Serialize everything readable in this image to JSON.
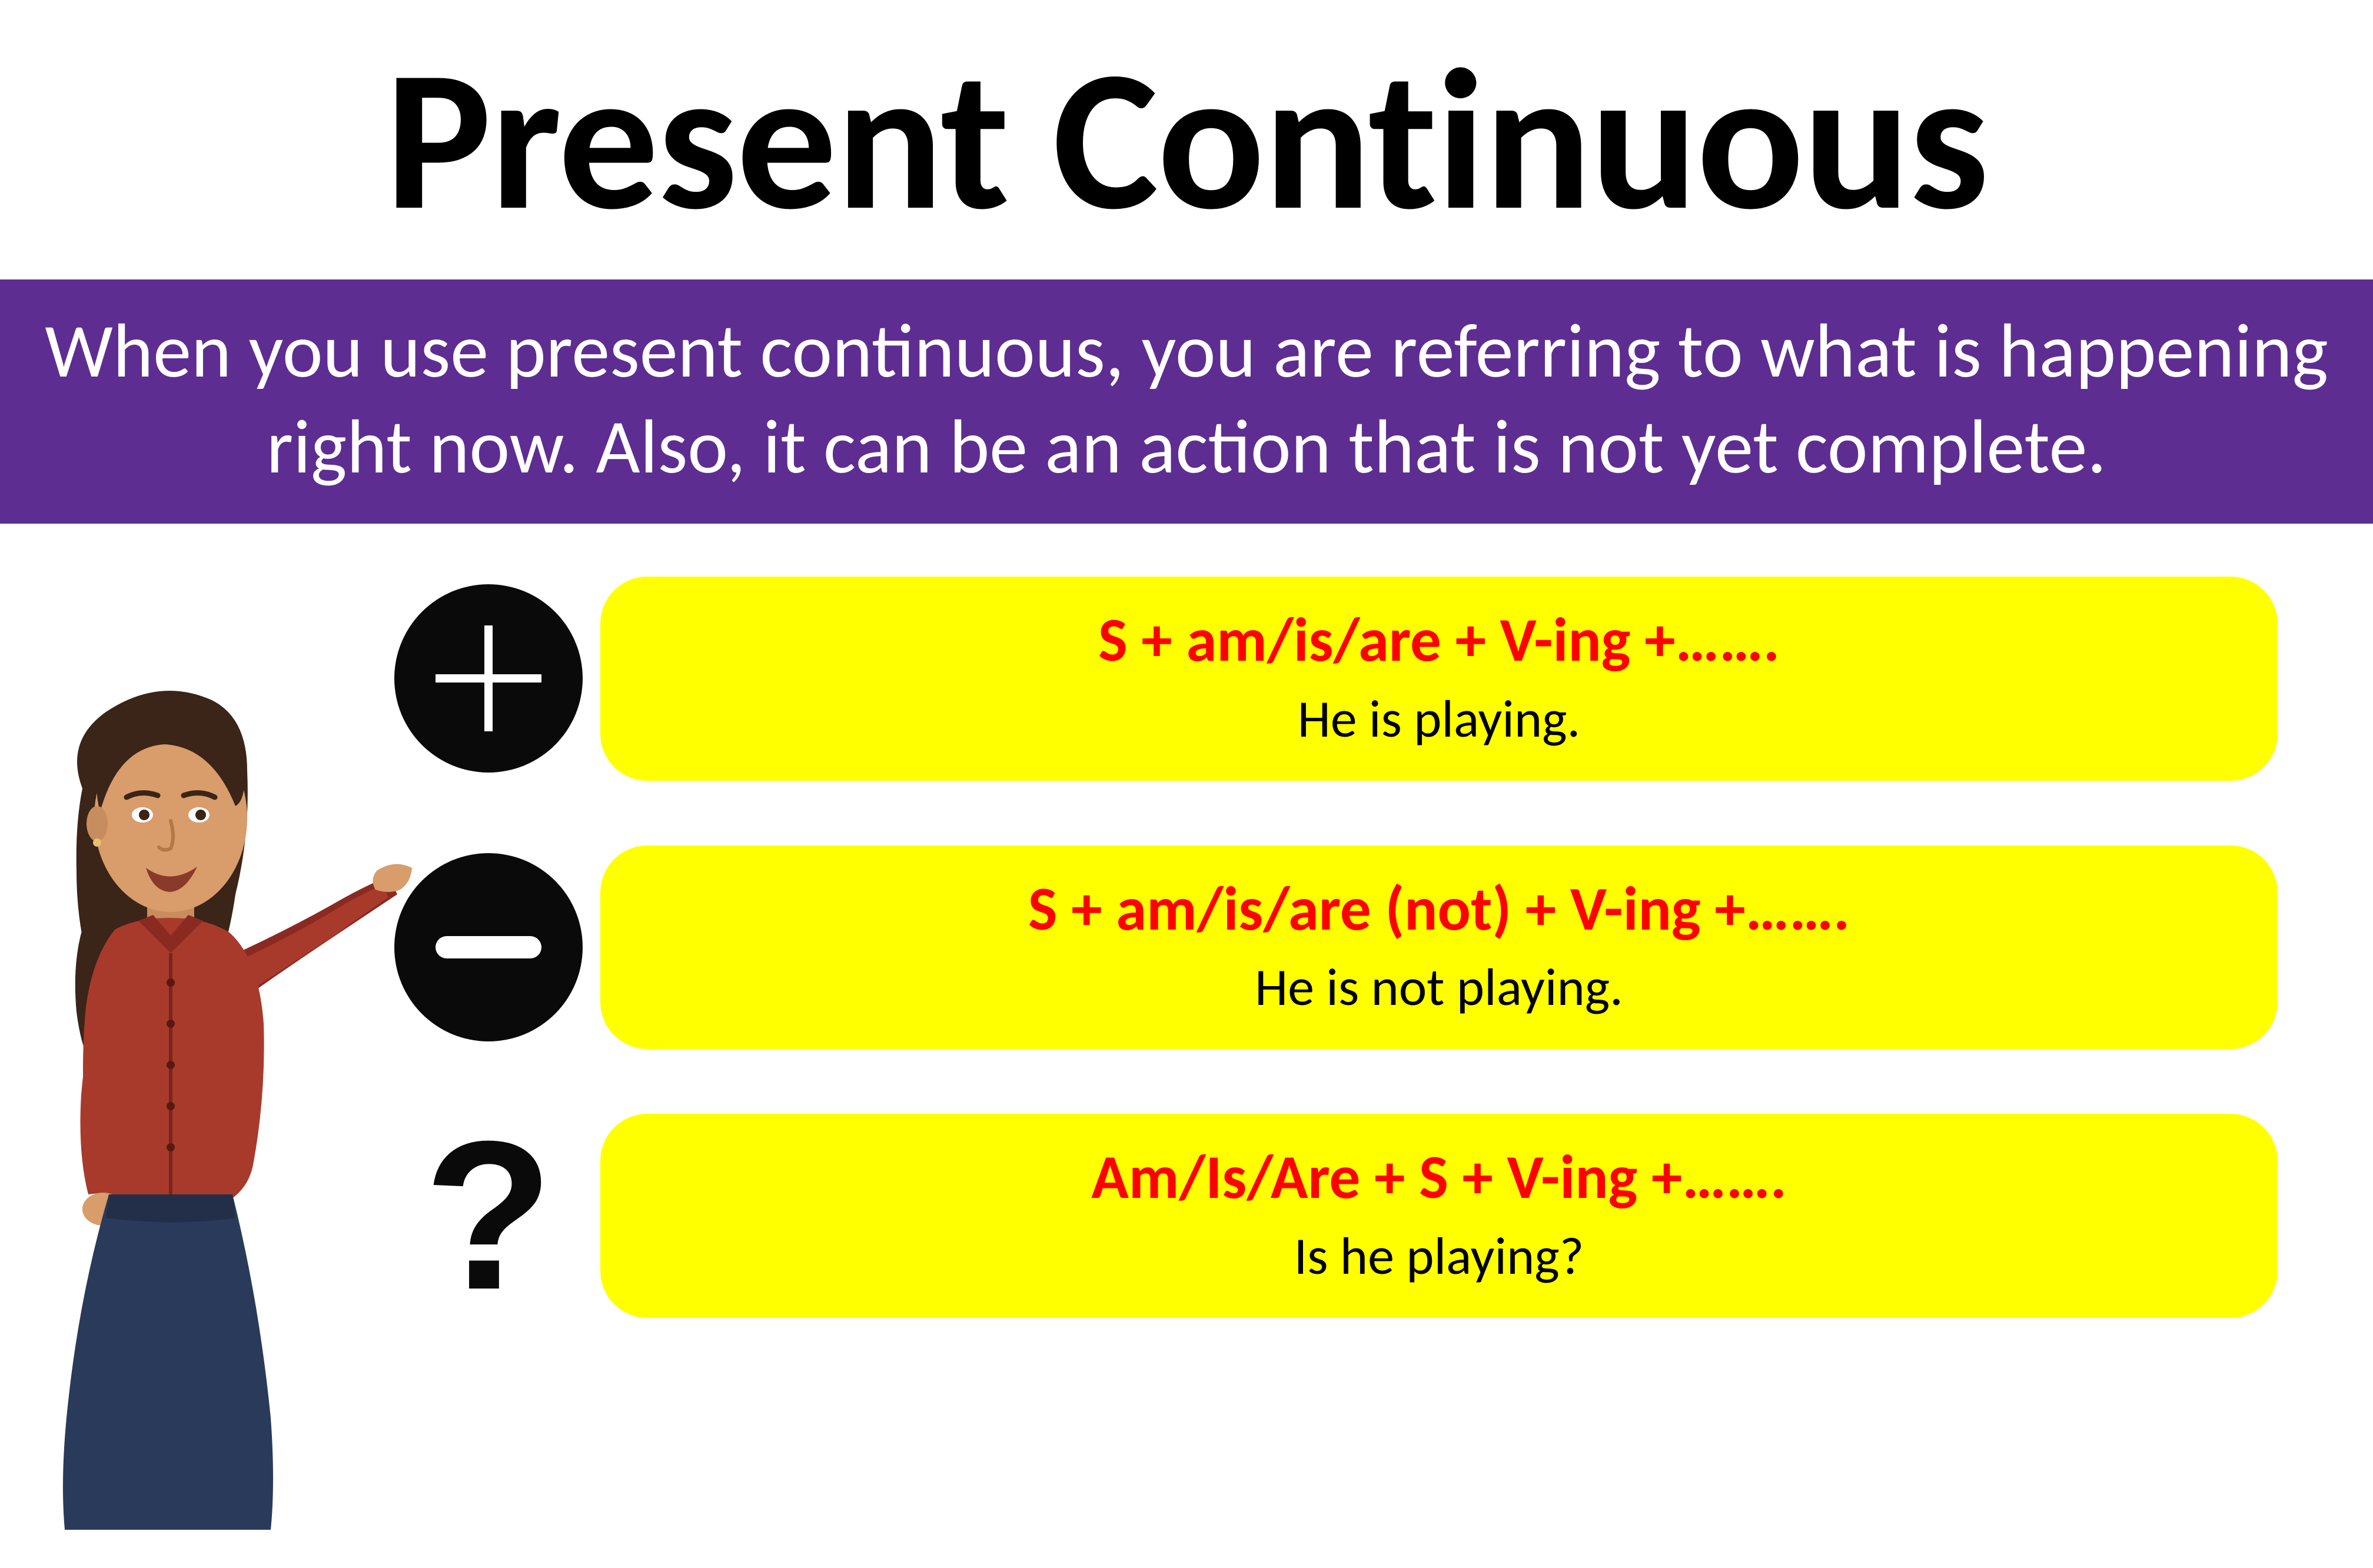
{
  "title": "Present Continuous",
  "subtitle": "When you use present continuous, you are referring to what is happening right now. Also, it can be an action that is not yet complete.",
  "rows": [
    {
      "formula": "S + am/is/are + V-ing +…….",
      "example": "He is playing."
    },
    {
      "formula": "S + am/is/are (not) + V-ing +…….",
      "example": "He is not playing."
    },
    {
      "formula": "Am/Is/Are + S + V-ing +…….",
      "example": "Is he playing?"
    }
  ]
}
